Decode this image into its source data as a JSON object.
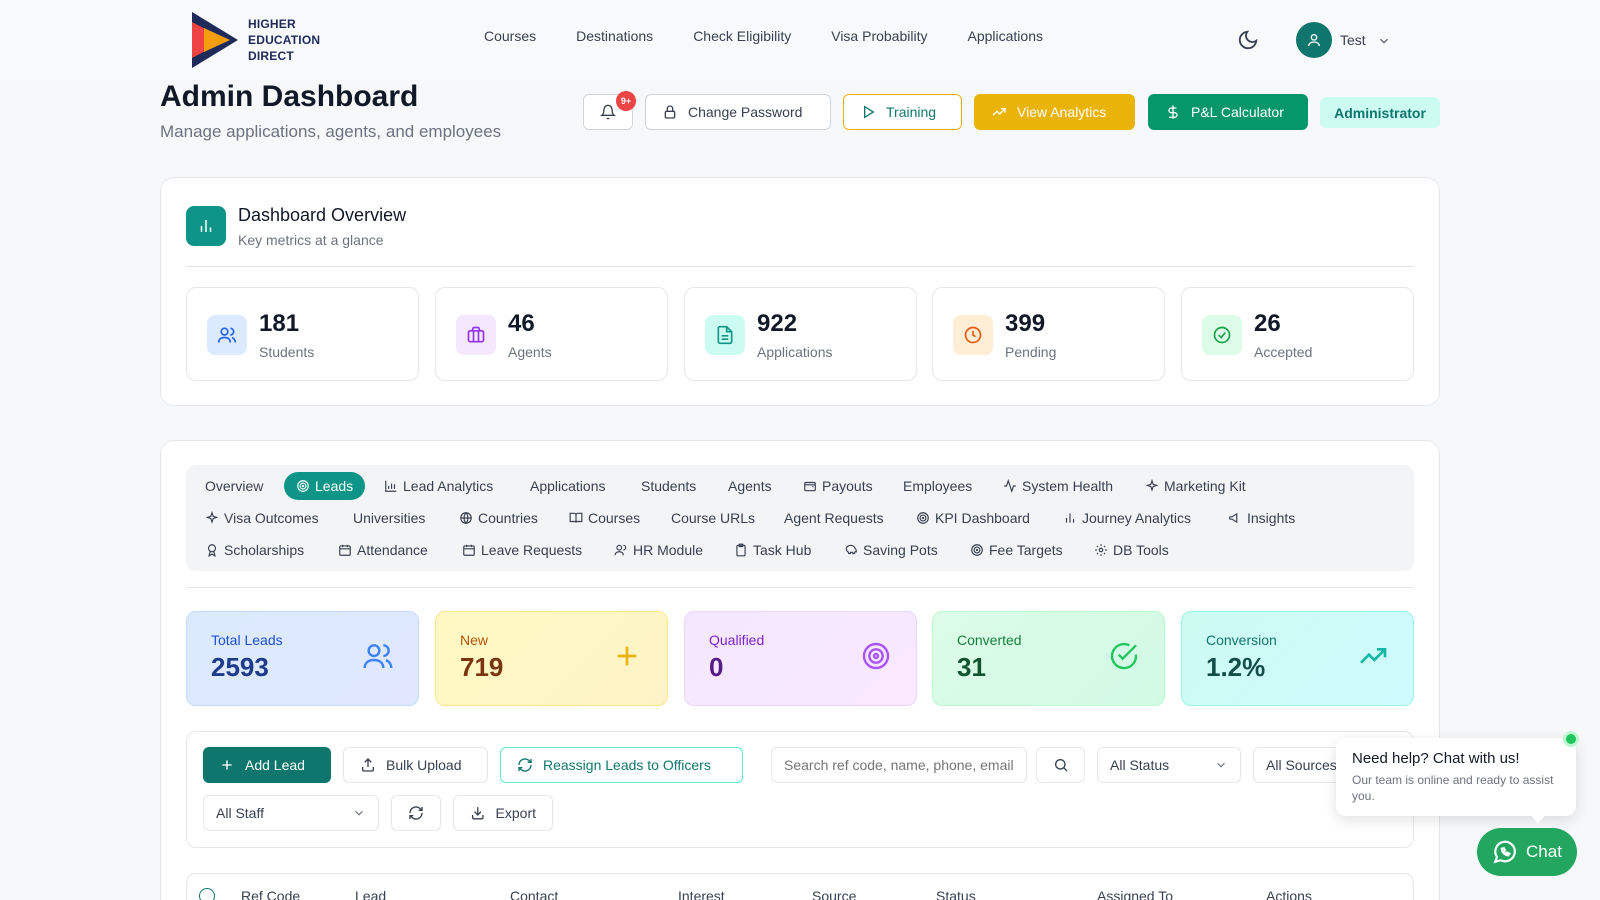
{
  "brand": {
    "line1": "HIGHER",
    "line2": "EDUCATION",
    "line3": "DIRECT"
  },
  "nav": {
    "links": [
      "Courses",
      "Destinations",
      "Check Eligibility",
      "Visa Probability",
      "Applications"
    ]
  },
  "user": {
    "name": "Test"
  },
  "page": {
    "title": "Admin Dashboard",
    "subtitle": "Manage applications, agents, and employees"
  },
  "header_actions": {
    "notif_badge": "9+",
    "change_password": "Change Password",
    "training": "Training",
    "view_analytics": "View Analytics",
    "pl_calculator": "P&L Calculator",
    "role": "Administrator"
  },
  "overview": {
    "title": "Dashboard Overview",
    "subtitle": "Key metrics at a glance",
    "stats": [
      {
        "value": "181",
        "label": "Students"
      },
      {
        "value": "46",
        "label": "Agents"
      },
      {
        "value": "922",
        "label": "Applications"
      },
      {
        "value": "399",
        "label": "Pending"
      },
      {
        "value": "26",
        "label": "Accepted"
      }
    ]
  },
  "tabs": {
    "row1": [
      "Overview",
      "Leads",
      "Lead Analytics",
      "Applications",
      "Students",
      "Agents",
      "Payouts",
      "Employees",
      "System Health",
      "Marketing Kit"
    ],
    "row2": [
      "Visa Outcomes",
      "Universities",
      "Countries",
      "Courses",
      "Course URLs",
      "Agent Requests",
      "KPI Dashboard",
      "Journey Analytics",
      "Insights"
    ],
    "row3": [
      "Scholarships",
      "Attendance",
      "Leave Requests",
      "HR Module",
      "Task Hub",
      "Saving Pots",
      "Fee Targets",
      "DB Tools"
    ],
    "active": "Leads"
  },
  "lead_stats": [
    {
      "label": "Total Leads",
      "value": "2593"
    },
    {
      "label": "New",
      "value": "719"
    },
    {
      "label": "Qualified",
      "value": "0"
    },
    {
      "label": "Converted",
      "value": "31"
    },
    {
      "label": "Conversion",
      "value": "1.2%"
    }
  ],
  "toolbar": {
    "add_lead": "Add Lead",
    "bulk_upload": "Bulk Upload",
    "reassign": "Reassign Leads to Officers",
    "search_placeholder": "Search ref code, name, phone, email",
    "status_filter": "All Status",
    "source_filter": "All Sources",
    "staff_filter": "All Staff",
    "export": "Export"
  },
  "table": {
    "headers": [
      "Ref Code",
      "Lead",
      "Contact",
      "Interest",
      "Source",
      "Status",
      "Assigned To",
      "Actions"
    ]
  },
  "chat": {
    "popup_title": "Need help? Chat with us!",
    "popup_text": "Our team is online and ready to assist you.",
    "button": "Chat"
  },
  "colors": {
    "teal": "#0f9488",
    "yellow": "#eab308",
    "green": "#059669"
  }
}
